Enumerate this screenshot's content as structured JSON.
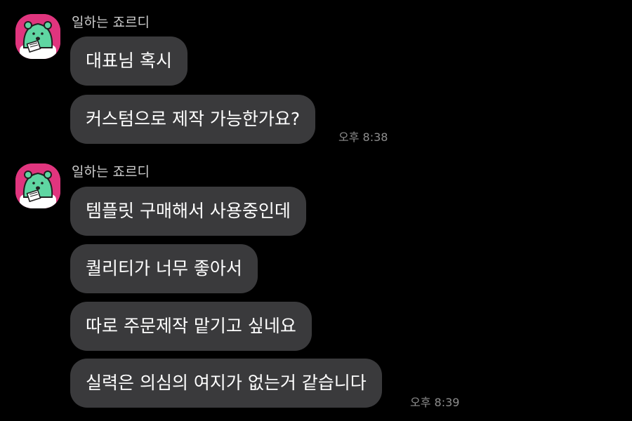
{
  "chat": {
    "groups": [
      {
        "sender": "일하는 죠르디",
        "messages": [
          "대표님 혹시",
          "커스텀으로 제작 가능한가요?"
        ],
        "time": "오후 8:38"
      },
      {
        "sender": "일하는 죠르디",
        "messages": [
          "템플릿 구매해서 사용중인데",
          "퀄리티가 너무 좋아서",
          "따로 주문제작 맡기고 싶네요",
          "실력은 의심의 여지가 없는거 같습니다"
        ],
        "time": "오후 8:39"
      }
    ]
  },
  "colors": {
    "background": "#000000",
    "bubble": "#3a3a3c",
    "avatar_bg": "#e0357e",
    "character": "#5fd6a2"
  },
  "icons": {
    "avatar": "jordy-character-avatar-icon"
  }
}
